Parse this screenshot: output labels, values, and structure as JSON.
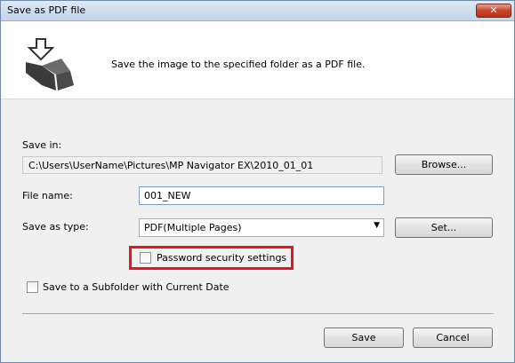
{
  "dialog": {
    "title": "Save as PDF file",
    "close_label": "✕",
    "description": "Save the image to the specified folder as a PDF file."
  },
  "save_in": {
    "label": "Save in:",
    "path": "C:\\Users\\UserName\\Pictures\\MP Navigator EX\\2010_01_01",
    "browse_label": "Browse..."
  },
  "file_name": {
    "label": "File name:",
    "value": "001_NEW"
  },
  "save_as_type": {
    "label": "Save as type:",
    "selected": "PDF(Multiple Pages)",
    "set_label": "Set..."
  },
  "options": {
    "password_label": "Password security settings",
    "password_checked": false,
    "subfolder_label": "Save to a Subfolder with Current Date",
    "subfolder_checked": false
  },
  "actions": {
    "save_label": "Save",
    "cancel_label": "Cancel"
  },
  "icons": {
    "banner": "save-folder-icon",
    "dropdown": "chevron-down-icon",
    "close": "close-icon"
  },
  "colors": {
    "highlight": "#e8161a",
    "close_button": "#c8452b"
  }
}
